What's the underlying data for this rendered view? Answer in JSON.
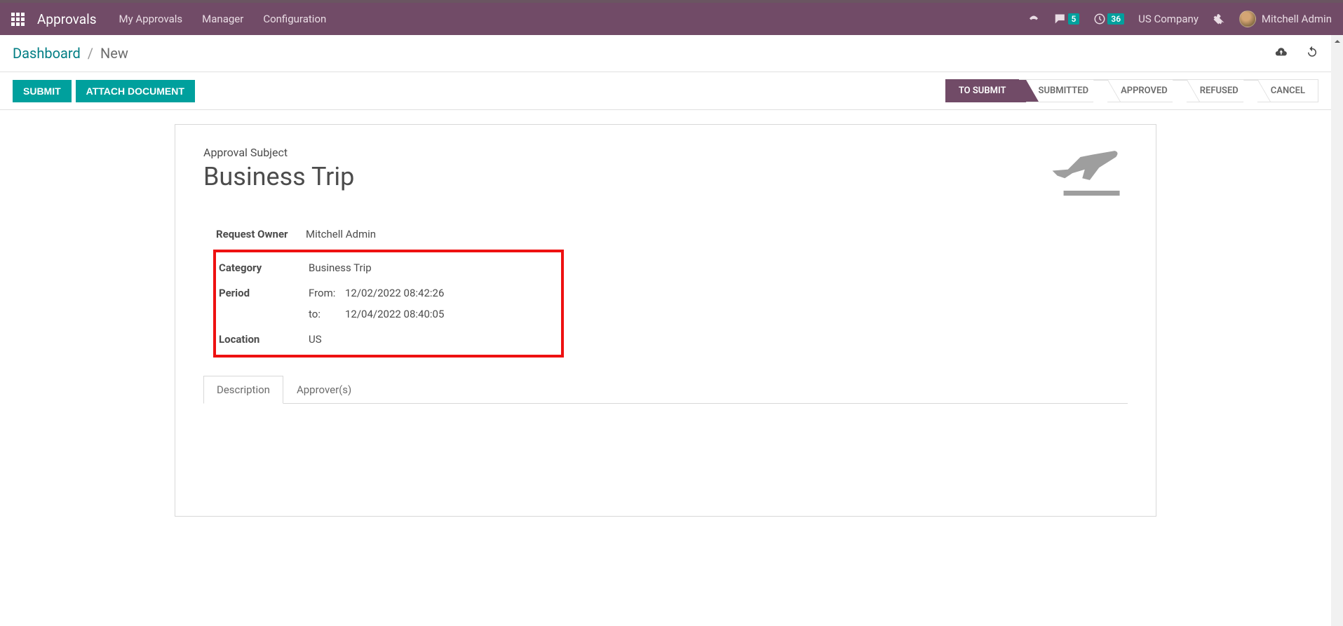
{
  "navbar": {
    "brand": "Approvals",
    "links": [
      "My Approvals",
      "Manager",
      "Configuration"
    ],
    "messages_badge": "5",
    "activities_badge": "36",
    "company": "US Company",
    "user": "Mitchell Admin"
  },
  "breadcrumb": {
    "root": "Dashboard",
    "current": "New"
  },
  "actions": {
    "submit": "SUBMIT",
    "attach": "ATTACH DOCUMENT"
  },
  "status_steps": [
    "TO SUBMIT",
    "SUBMITTED",
    "APPROVED",
    "REFUSED",
    "CANCEL"
  ],
  "form": {
    "subject_label": "Approval Subject",
    "subject_value": "Business Trip",
    "fields": {
      "owner_label": "Request Owner",
      "owner_value": "Mitchell Admin",
      "category_label": "Category",
      "category_value": "Business Trip",
      "period_label": "Period",
      "period_from_label": "From:",
      "period_from_value": "12/02/2022 08:42:26",
      "period_to_label": "to:",
      "period_to_value": "12/04/2022 08:40:05",
      "location_label": "Location",
      "location_value": "US"
    }
  },
  "tabs": [
    "Description",
    "Approver(s)"
  ]
}
